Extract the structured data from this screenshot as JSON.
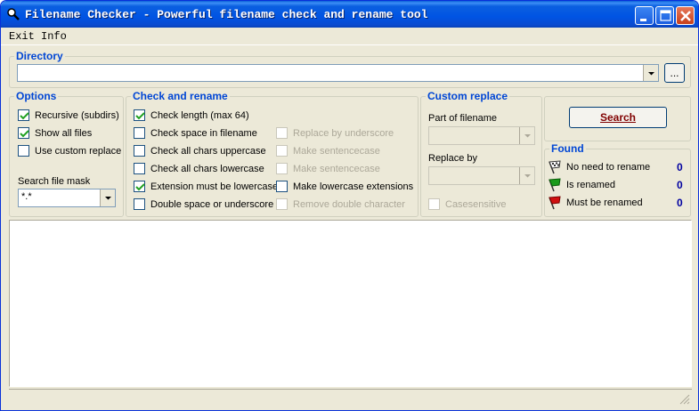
{
  "window": {
    "title": "Filename Checker - Powerful filename check and rename tool"
  },
  "menu": {
    "exit": "Exit",
    "info": "Info"
  },
  "directory": {
    "title": "Directory",
    "value": "",
    "browse_label": "..."
  },
  "options": {
    "title": "Options",
    "items": [
      {
        "label": "Recursive (subdirs)",
        "checked": true
      },
      {
        "label": "Show all files",
        "checked": true
      },
      {
        "label": "Use custom replace",
        "checked": false
      }
    ],
    "mask_label": "Search file mask",
    "mask_value": "*.*"
  },
  "check_rename": {
    "title": "Check and rename",
    "left": [
      {
        "label": "Check length (max 64)",
        "checked": true
      },
      {
        "label": "Check space in filename",
        "checked": false
      },
      {
        "label": "Check all chars uppercase",
        "checked": false
      },
      {
        "label": "Check all chars lowercase",
        "checked": false
      },
      {
        "label": "Extension must be lowercase",
        "checked": true
      },
      {
        "label": "Double space or underscore",
        "checked": false
      }
    ],
    "right": [
      {
        "label": "Replace by underscore",
        "checked": false,
        "disabled": true
      },
      {
        "label": "Make sentencecase",
        "checked": false,
        "disabled": true
      },
      {
        "label": "Make sentencecase",
        "checked": false,
        "disabled": true
      },
      {
        "label": "Make lowercase extensions",
        "checked": false,
        "disabled": false
      },
      {
        "label": "Remove double character",
        "checked": false,
        "disabled": true
      }
    ]
  },
  "custom_replace": {
    "title": "Custom replace",
    "part_label": "Part of filename",
    "replace_label": "Replace by",
    "casesensitive": "Casesensitive"
  },
  "search_button": "Search",
  "found": {
    "title": "Found",
    "rows": [
      {
        "label": "No need to rename",
        "count": "0",
        "flag_color": "#ffffff"
      },
      {
        "label": "Is renamed",
        "count": "0",
        "flag_color": "#1a9a1a"
      },
      {
        "label": "Must be renamed",
        "count": "0",
        "flag_color": "#d01010"
      }
    ]
  }
}
